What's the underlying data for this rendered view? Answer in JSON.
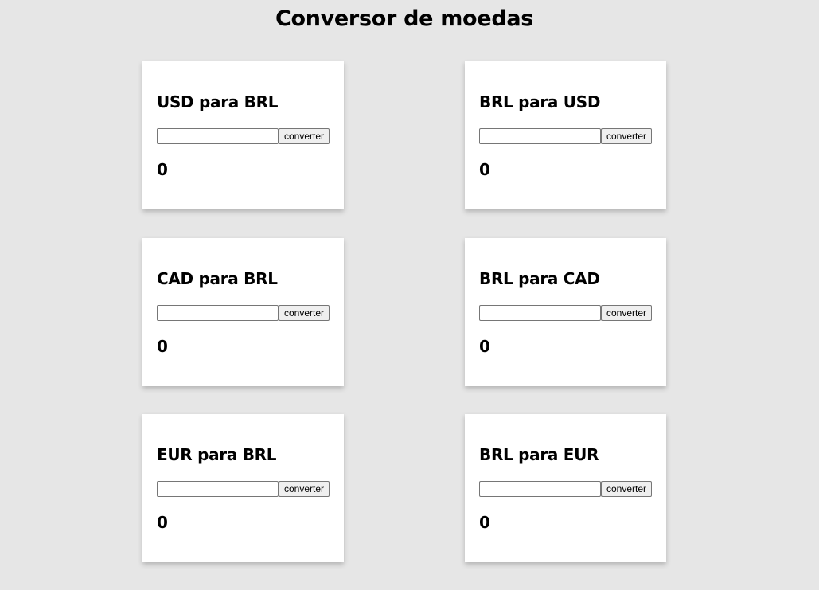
{
  "page": {
    "title": "Conversor de moedas"
  },
  "converters": [
    {
      "title": "USD para BRL",
      "input_value": "",
      "button_label": "converter",
      "result": "0"
    },
    {
      "title": "BRL para USD",
      "input_value": "",
      "button_label": "converter",
      "result": "0"
    },
    {
      "title": "CAD para BRL",
      "input_value": "",
      "button_label": "converter",
      "result": "0"
    },
    {
      "title": "BRL para CAD",
      "input_value": "",
      "button_label": "converter",
      "result": "0"
    },
    {
      "title": "EUR para BRL",
      "input_value": "",
      "button_label": "converter",
      "result": "0"
    },
    {
      "title": "BRL para EUR",
      "input_value": "",
      "button_label": "converter",
      "result": "0"
    }
  ],
  "colors": {
    "background": "#e6e6e6",
    "card": "#ffffff",
    "button": "#efefef"
  }
}
